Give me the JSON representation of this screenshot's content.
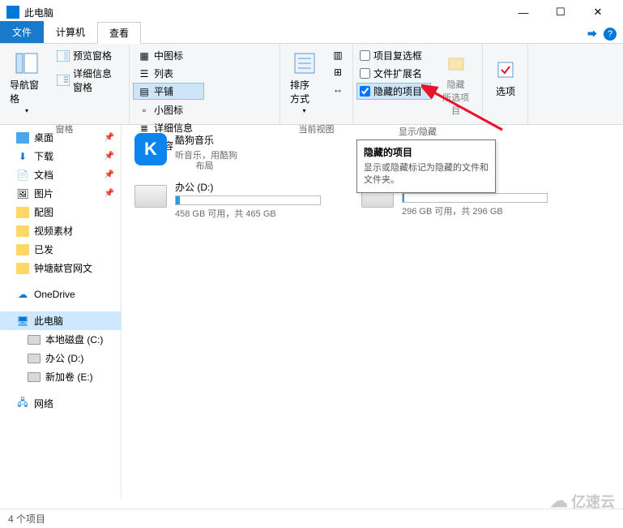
{
  "titlebar": {
    "title": "此电脑"
  },
  "tabs": {
    "file": "文件",
    "computer": "计算机",
    "view": "查看"
  },
  "ribbon": {
    "panes": {
      "nav_pane": "导航窗格",
      "preview_pane": "预览窗格",
      "details_pane": "详细信息窗格",
      "group_label": "窗格"
    },
    "layout": {
      "medium_icons": "中图标",
      "small_icons": "小图标",
      "list": "列表",
      "details": "详细信息",
      "tiles": "平铺",
      "content": "内容",
      "group_label": "布局"
    },
    "current_view": {
      "sort_by": "排序方式",
      "group_label": "当前视图"
    },
    "show_hide": {
      "item_checkboxes": "项目复选框",
      "file_ext": "文件扩展名",
      "hidden_items": "隐藏的项目",
      "hide_selected": "隐藏\n所选项目",
      "group_label": "显示/隐藏"
    },
    "options": {
      "label": "选项"
    }
  },
  "sidebar": {
    "desktop": "桌面",
    "downloads": "下载",
    "documents": "文档",
    "pictures": "图片",
    "peitu": "配图",
    "video_src": "视频素材",
    "yifa": "已发",
    "zhongtang": "钟塘献官网文",
    "onedrive": "OneDrive",
    "this_pc": "此电脑",
    "local_c": "本地磁盘 (C:)",
    "office_d": "办公 (D:)",
    "new_e": "新加卷 (E:)",
    "network": "网络"
  },
  "content": {
    "kugou": {
      "title": "酷狗音乐",
      "sub": "听音乐，用酷狗"
    },
    "drive_d": {
      "title": "办公 (D:)",
      "sub": "458 GB 可用，共 465 GB",
      "fill_pct": 3
    },
    "drive_e": {
      "sub": "296 GB 可用，共 296 GB",
      "fill_pct": 1
    }
  },
  "tooltip": {
    "title": "隐藏的项目",
    "body": "显示或隐藏标记为隐藏的文件和文件夹。"
  },
  "statusbar": {
    "count": "4 个项目"
  },
  "watermark": "亿速云"
}
